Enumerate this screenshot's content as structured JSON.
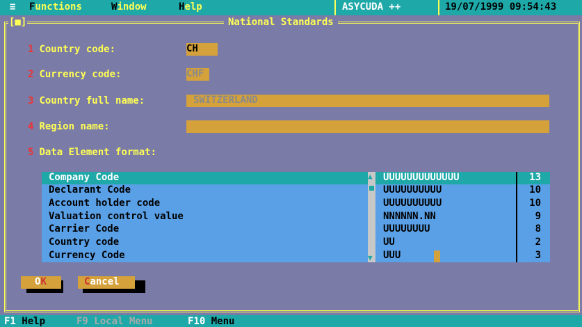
{
  "menubar": {
    "sys_icon": "≡",
    "items": [
      {
        "hot": "F",
        "rest": "unctions"
      },
      {
        "hot": "W",
        "rest": "indow"
      },
      {
        "hot": "H",
        "rest": "elp"
      }
    ],
    "app_name": "ASYCUDA ++",
    "datetime": "19/07/1999 09:54:43"
  },
  "window": {
    "control_label": "[■]",
    "title": "National Standards"
  },
  "form": {
    "fields": [
      {
        "num": "1",
        "label": "Country code:",
        "value": "CH"
      },
      {
        "num": "2",
        "label": "Currency code:",
        "value": "CHF"
      },
      {
        "num": "3",
        "label": "Country full name:",
        "value": "SWITZERLAND"
      },
      {
        "num": "4",
        "label": "Region name:",
        "value": ""
      },
      {
        "num": "5",
        "label": "Data Element format:"
      }
    ]
  },
  "list": {
    "rows": [
      {
        "name": "Company Code",
        "format": "UUUUUUUUUUUUU",
        "length": "13",
        "selected": true
      },
      {
        "name": "Declarant Code",
        "format": "UUUUUUUUUU",
        "length": "10"
      },
      {
        "name": "Account holder code",
        "format": "UUUUUUUUUU",
        "length": "10"
      },
      {
        "name": "Valuation control value",
        "format": "NNNNNN.NN",
        "length": "9"
      },
      {
        "name": "Carrier Code",
        "format": "UUUUUUUU",
        "length": "8"
      },
      {
        "name": "Country code",
        "format": "UU",
        "length": "2"
      },
      {
        "name": "Currency Code",
        "format": "UUU",
        "length": "3"
      }
    ],
    "scroll_up_icon": "▲",
    "scroll_down_icon": "▼"
  },
  "buttons": {
    "ok": {
      "hot": "O",
      "rest": "K"
    },
    "cancel": {
      "hot": "C",
      "rest": "ancel"
    }
  },
  "statusbar": {
    "items": [
      {
        "key": "F1",
        "label": "Help",
        "enabled": true
      },
      {
        "key": "F9",
        "label": "Local Menu",
        "enabled": false
      },
      {
        "key": "F10",
        "label": "Menu",
        "enabled": true
      }
    ]
  },
  "colors": {
    "background": "#7a7ba6",
    "accent_cyan": "#1ea8a8",
    "field_gold": "#d4a13b",
    "list_blue": "#5aa0e6",
    "label_yellow": "#ffff55",
    "number_red": "#e33333"
  }
}
